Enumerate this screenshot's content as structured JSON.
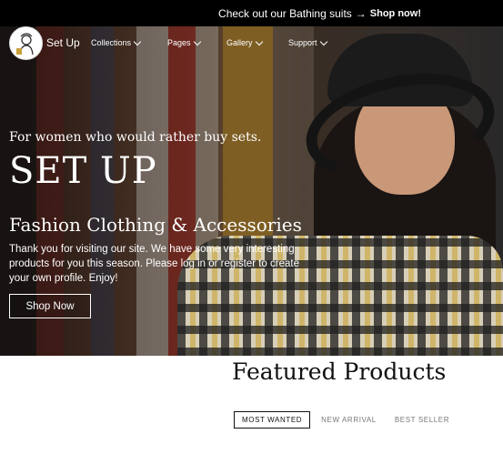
{
  "announcement": {
    "text": "Check out our Bathing suits",
    "arrow": "→",
    "cta": "Shop now!"
  },
  "nav": {
    "brand": "Set Up",
    "items": [
      {
        "label": "Collections"
      },
      {
        "label": "Pages"
      },
      {
        "label": "Gallery"
      },
      {
        "label": "Support"
      }
    ]
  },
  "hero": {
    "tagline": "For women who would rather buy sets.",
    "title": "SET UP",
    "subtitle": "Fashion Clothing & Accessories",
    "description": "Thank you for visiting our site. We have some very interesting products for you this season. Please log in or register to create your own profile. Enjoy!",
    "button": "Shop Now"
  },
  "featured": {
    "title": "Featured Products",
    "tabs": [
      {
        "label": "MOST WANTED",
        "active": true
      },
      {
        "label": "NEW ARRIVAL",
        "active": false
      },
      {
        "label": "BEST SELLER",
        "active": false
      }
    ]
  },
  "colors": {
    "announcement_bg": "#000000",
    "text": "#ffffff",
    "heading_dark": "#111111",
    "tab_muted": "#777777"
  }
}
